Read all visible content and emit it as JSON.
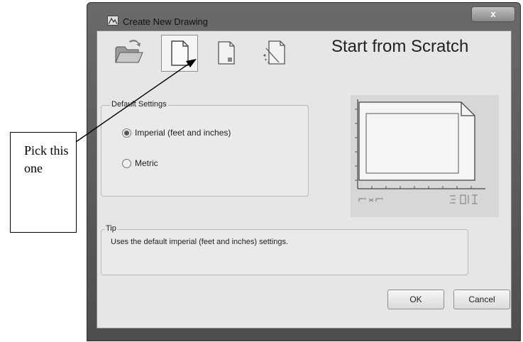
{
  "window": {
    "title": "Create New Drawing",
    "close_label": "x"
  },
  "modes": [
    {
      "name": "open-drawing",
      "icon": "folder-open-icon"
    },
    {
      "name": "start-from-scratch",
      "icon": "blank-page-icon",
      "selected": true
    },
    {
      "name": "use-template",
      "icon": "template-page-icon"
    },
    {
      "name": "use-wizard",
      "icon": "wizard-page-icon"
    }
  ],
  "mode_title": "Start from Scratch",
  "default_settings": {
    "legend": "Default Settings",
    "options": [
      {
        "label": "Imperial (feet and inches)",
        "checked": true
      },
      {
        "label": "Metric",
        "checked": false
      }
    ]
  },
  "tip": {
    "legend": "Tip",
    "text": "Uses the default imperial (feet and inches) settings."
  },
  "buttons": {
    "ok": "OK",
    "cancel": "Cancel"
  },
  "annotation": {
    "text": "Pick this one"
  },
  "colors": {
    "frame": "#5a5a5a",
    "panel": "#e6e6e6",
    "preview": "#d7d7d7"
  }
}
